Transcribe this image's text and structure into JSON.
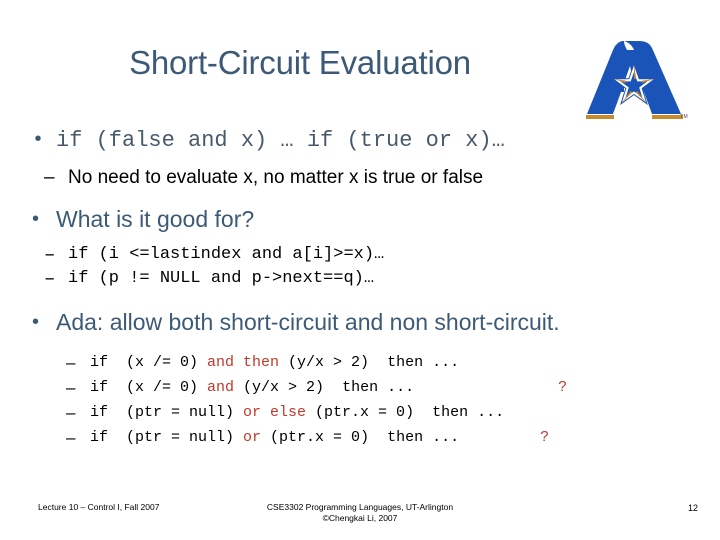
{
  "slide": {
    "title": "Short-Circuit Evaluation",
    "accent_color": "#3C5A77",
    "keyword_color": "#C0392B",
    "background_color": "#FFFFFF"
  },
  "logo": {
    "name": "uta-a-star-logo",
    "trademark": "TM",
    "primary_color": "#1B54B8",
    "accent_color": "#C8892E"
  },
  "body": {
    "bullet1": {
      "code": "if (false and x) … if (true or x)…",
      "sub1": "No need to evaluate x, no matter x is true or false"
    },
    "bullet2": {
      "text": "What is it good for?",
      "sub1": "if (i <=lastindex and a[i]>=x)…",
      "sub2": "if (p != NULL and p->next==q)…"
    },
    "bullet3": {
      "text": "Ada: allow both short-circuit and non short-circuit.",
      "lines": [
        {
          "pre": "if  (x /= 0) ",
          "kw": "and then",
          "post": " (y/x > 2)  then ...",
          "tail": ""
        },
        {
          "pre": "if  (x /= 0) ",
          "kw": "and",
          "post": " (y/x > 2)  then ...",
          "tail": "?"
        },
        {
          "pre": "if  (ptr = null) ",
          "kw": "or else",
          "post": " (ptr.x = 0)  then ...",
          "tail": ""
        },
        {
          "pre": "if  (ptr = null) ",
          "kw": "or",
          "post": " (ptr.x = 0)  then ...",
          "tail": "?"
        }
      ]
    }
  },
  "footer": {
    "left": "Lecture 10 – Control I, Fall 2007",
    "center_line1": "CSE3302 Programming Languages, UT-Arlington",
    "center_line2": "©Chengkai Li, 2007",
    "page_number": "12"
  }
}
